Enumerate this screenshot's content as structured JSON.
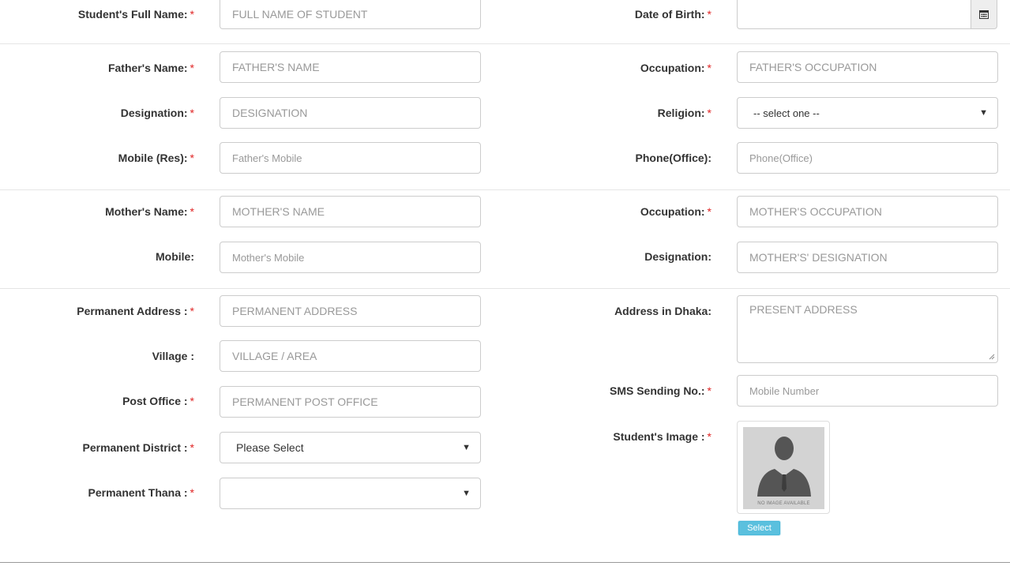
{
  "student": {
    "full_name": {
      "label": "Student's Full Name:",
      "req": "*",
      "placeholder": "FULL NAME OF STUDENT"
    },
    "dob": {
      "label": "Date of Birth:",
      "req": "*",
      "value": ""
    }
  },
  "father": {
    "name": {
      "label": "Father's Name:",
      "req": "*",
      "placeholder": "FATHER'S NAME"
    },
    "occupation": {
      "label": "Occupation:",
      "req": "*",
      "placeholder": "FATHER'S OCCUPATION"
    },
    "designation": {
      "label": "Designation:",
      "req": "*",
      "placeholder": "DESIGNATION"
    },
    "religion": {
      "label": "Religion:",
      "req": "*",
      "selected": "-- select one --"
    },
    "mobile": {
      "label": "Mobile (Res):",
      "req": "*",
      "placeholder": "Father's Mobile"
    },
    "phone_office": {
      "label": "Phone(Office):",
      "placeholder": "Phone(Office)"
    }
  },
  "mother": {
    "name": {
      "label": "Mother's Name:",
      "req": "*",
      "placeholder": "MOTHER'S NAME"
    },
    "occupation": {
      "label": "Occupation:",
      "req": "*",
      "placeholder": "MOTHER'S OCCUPATION"
    },
    "mobile": {
      "label": "Mobile:",
      "placeholder": "Mother's Mobile"
    },
    "designation": {
      "label": "Designation:",
      "placeholder": "MOTHER'S' DESIGNATION"
    }
  },
  "address": {
    "permanent": {
      "label": "Permanent Address :",
      "req": "*",
      "placeholder": "PERMANENT ADDRESS"
    },
    "dhaka": {
      "label": "Address in Dhaka:",
      "placeholder": "PRESENT ADDRESS"
    },
    "village": {
      "label": "Village :",
      "placeholder": "VILLAGE / AREA"
    },
    "post_office": {
      "label": "Post Office :",
      "req": "*",
      "placeholder": "PERMANENT POST OFFICE"
    },
    "sms": {
      "label": "SMS Sending No.:",
      "req": "*",
      "placeholder": "Mobile Number"
    },
    "district": {
      "label": "Permanent District :",
      "req": "*",
      "selected": "Please Select"
    },
    "thana": {
      "label": "Permanent Thana :",
      "req": "*",
      "selected": ""
    },
    "image": {
      "label": "Student's Image :",
      "req": "*",
      "no_image_text": "NO IMAGE AVAILABLE",
      "select_label": "Select"
    }
  },
  "icons": {
    "calendar": "calendar-icon",
    "dropdown": "chevron-down-icon"
  },
  "colors": {
    "required": "#e02424",
    "select_button": "#5bc0de"
  }
}
